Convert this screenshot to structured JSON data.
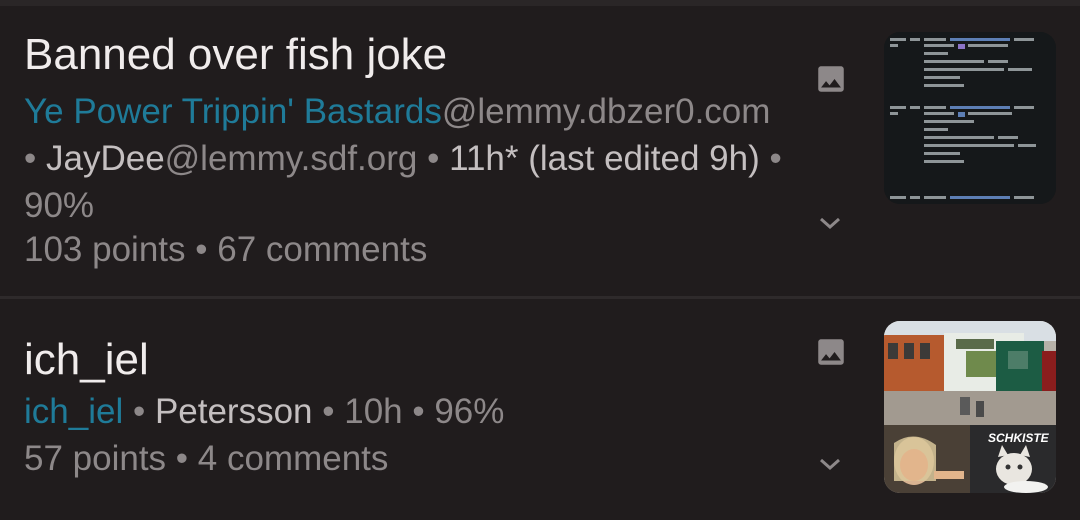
{
  "posts": [
    {
      "title": "Banned over fish joke",
      "community_name": "Ye Power Trippin' Bastards",
      "community_instance": "@lemmy.dbzer0​.com",
      "sep1": " • ",
      "user_name": "JayDee",
      "user_instance": "@lemmy.sdf.org",
      "sep2": " • ",
      "time": "11h* (last edited 9h)",
      "sep3": " • ",
      "upvote_ratio": "90%",
      "points": "103 points",
      "sep4": " • ",
      "comments": "67 comments",
      "media_icon": "image-icon",
      "expand_icon": "chevron-down-icon"
    },
    {
      "title": "ich_iel",
      "community_name": "ich_iel",
      "sep1": " • ",
      "user_name": "Petersson",
      "sep2": " • ",
      "time": "10h",
      "sep3": " • ",
      "upvote_ratio": "96%",
      "points": "57 points",
      "sep4": " • ",
      "comments": "4 comments",
      "thumbnail_caption": "SCHKISTE",
      "media_icon": "image-icon",
      "expand_icon": "chevron-down-icon"
    }
  ],
  "colors": {
    "background": "#201c1d",
    "community": "#1f7b99",
    "meta": "#8d8889",
    "user": "#c4bfc0",
    "title": "#f0ecec"
  }
}
